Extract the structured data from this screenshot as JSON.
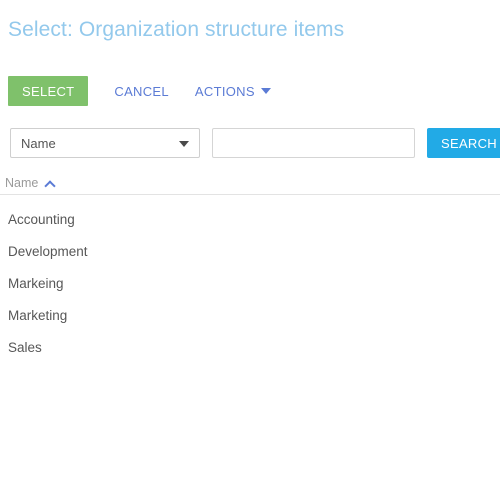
{
  "window": {
    "title": "Select: Organization structure items"
  },
  "toolbar": {
    "select_label": "SELECT",
    "cancel_label": "CANCEL",
    "actions_label": "ACTIONS",
    "actions_caret_icon": "caret-down-icon"
  },
  "search": {
    "field_selected": "Name",
    "field_caret_icon": "caret-down-icon",
    "query_value": "",
    "query_placeholder": "",
    "search_label": "SEARCH"
  },
  "table": {
    "columns": [
      {
        "label": "Name",
        "sort": "ascending",
        "sort_icon": "chevron-up-icon"
      }
    ],
    "rows": [
      {
        "name": "Accounting"
      },
      {
        "name": "Development"
      },
      {
        "name": "Markeing"
      },
      {
        "name": "Marketing"
      },
      {
        "name": "Sales"
      }
    ]
  },
  "colors": {
    "title": "#93c9ec",
    "select_button": "#7fc16b",
    "search_button": "#22aae6",
    "link": "#5b7bd5",
    "row_text": "#575757",
    "header_text": "#9a9a9a",
    "divider": "#e3e3e3"
  }
}
